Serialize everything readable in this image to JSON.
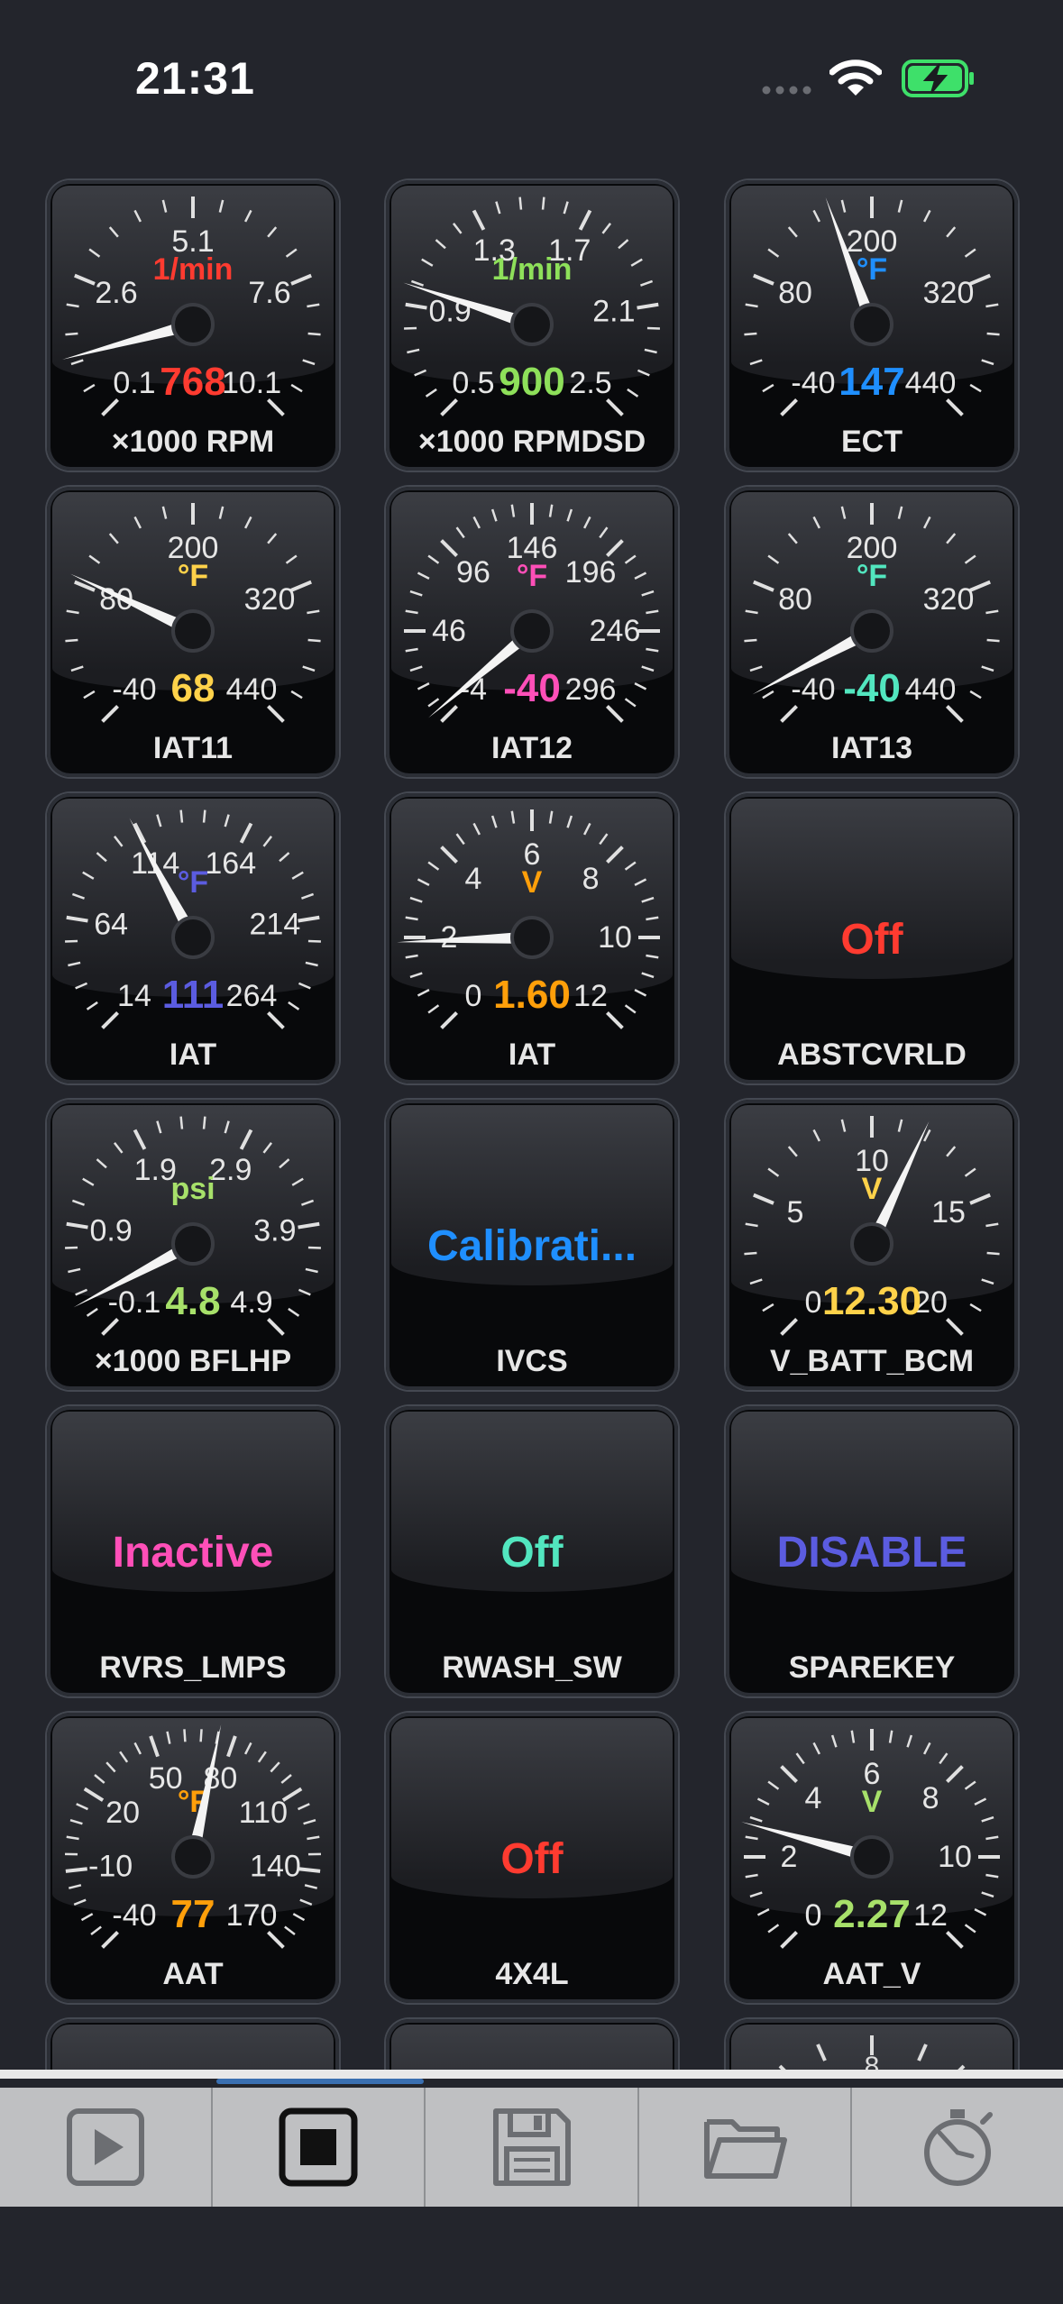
{
  "status_bar": {
    "time": "21:31"
  },
  "colors": {
    "red": "#ff3b30",
    "green": "#8ee05a",
    "blue": "#1f8fff",
    "yellow": "#ffd24a",
    "pink": "#ff4fb8",
    "teal": "#52e6bf",
    "indigo": "#5b5ce0",
    "orange": "#ff9f0a",
    "light_green": "#a7e06a",
    "cyan": "#4cd9d0"
  },
  "gauges": [
    {
      "id": "rpm",
      "name": "×1000 RPM",
      "unit": "1/min",
      "unit_color": "red",
      "value": "768",
      "value_color": "red",
      "ticks": [
        "0.1",
        "2.6",
        "5.1",
        "7.6",
        "10.1"
      ],
      "needle_angle": -105
    },
    {
      "id": "rpmdsd",
      "name": "×1000 RPMDSD",
      "unit": "1/min",
      "unit_color": "green",
      "value": "900",
      "value_color": "green",
      "ticks": [
        "0.5",
        "0.9",
        "1.3",
        "1.7",
        "2.1",
        "2.5"
      ],
      "needle_angle": -72
    },
    {
      "id": "ect",
      "name": "ECT",
      "unit": "°F",
      "unit_color": "blue",
      "value": "147",
      "value_color": "blue",
      "ticks": [
        "-40",
        "80",
        "200",
        "320",
        "440"
      ],
      "needle_angle": -20
    },
    {
      "id": "iat11",
      "name": "IAT11",
      "unit": "°F",
      "unit_color": "yellow",
      "value": "68",
      "value_color": "yellow",
      "ticks": [
        "-40",
        "80",
        "200",
        "320",
        "440"
      ],
      "needle_angle": -65
    },
    {
      "id": "iat12",
      "name": "IAT12",
      "unit": "°F",
      "unit_color": "pink",
      "value": "-40",
      "value_color": "pink",
      "ticks": [
        "-4",
        "46",
        "96",
        "146",
        "196",
        "246",
        "296"
      ],
      "needle_angle": -130
    },
    {
      "id": "iat13",
      "name": "IAT13",
      "unit": "°F",
      "unit_color": "teal",
      "value": "-40",
      "value_color": "teal",
      "ticks": [
        "-40",
        "80",
        "200",
        "320",
        "440"
      ],
      "needle_angle": -118
    },
    {
      "id": "iat",
      "name": "IAT",
      "unit": "°F",
      "unit_color": "indigo",
      "value": "111",
      "value_color": "indigo",
      "ticks": [
        "14",
        "64",
        "114",
        "164",
        "214",
        "264"
      ],
      "needle_angle": -28
    },
    {
      "id": "iat_v",
      "name": "IAT",
      "unit": "V",
      "unit_color": "orange",
      "value": "1.60",
      "value_color": "orange",
      "ticks": [
        "0",
        "2",
        "4",
        "6",
        "8",
        "10",
        "12"
      ],
      "needle_angle": -92
    },
    {
      "id": "bflhp",
      "name": "×1000 BFLHP",
      "unit": "psi",
      "unit_color": "light_green",
      "value": "4.8",
      "value_color": "light_green",
      "ticks": [
        "-0.1",
        "0.9",
        "1.9",
        "2.9",
        "3.9",
        "4.9"
      ],
      "needle_angle": -118
    },
    {
      "id": "vbatt",
      "name": "V_BATT_BCM",
      "unit": "V",
      "unit_color": "yellow",
      "value": "12.30",
      "value_color": "yellow",
      "ticks": [
        "0",
        "5",
        "10",
        "15",
        "20"
      ],
      "needle_angle": 25
    },
    {
      "id": "aat",
      "name": "AAT",
      "unit": "°F",
      "unit_color": "orange",
      "value": "77",
      "value_color": "orange",
      "ticks": [
        "-40",
        "-10",
        "20",
        "50",
        "80",
        "110",
        "140",
        "170"
      ],
      "needle_angle": 12
    },
    {
      "id": "aat_v",
      "name": "AAT_V",
      "unit": "V",
      "unit_color": "light_green",
      "value": "2.27",
      "value_color": "light_green",
      "ticks": [
        "0",
        "2",
        "4",
        "6",
        "8",
        "10",
        "12"
      ],
      "needle_angle": -75
    }
  ],
  "status_cells": [
    {
      "id": "abstcvrld",
      "name": "ABSTCVRLD",
      "text": "Off",
      "color": "red"
    },
    {
      "id": "ivcs",
      "name": "IVCS",
      "text": "Calibrati...",
      "color": "blue"
    },
    {
      "id": "rvrs_lmps",
      "name": "RVRS_LMPS",
      "text": "Inactive",
      "color": "pink"
    },
    {
      "id": "rwash_sw",
      "name": "RWASH_SW",
      "text": "Off",
      "color": "teal"
    },
    {
      "id": "sparekey",
      "name": "SPAREKEY",
      "text": "DISABLE",
      "color": "indigo"
    },
    {
      "id": "4x4l",
      "name": "4X4L",
      "text": "Off",
      "color": "red"
    }
  ],
  "partial_row": {
    "visible_tick": "8"
  },
  "toolbar": {
    "items": [
      {
        "id": "play",
        "icon": "play-icon"
      },
      {
        "id": "stop",
        "icon": "stop-icon"
      },
      {
        "id": "save",
        "icon": "save-icon"
      },
      {
        "id": "open",
        "icon": "folder-icon"
      },
      {
        "id": "timer",
        "icon": "stopwatch-icon"
      }
    ]
  }
}
